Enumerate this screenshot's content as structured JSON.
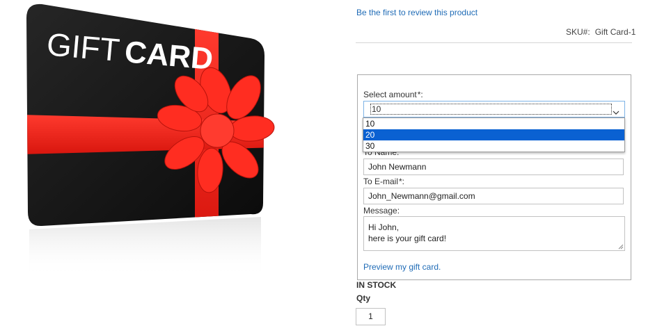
{
  "product_image": {
    "card_text_light": "GIFT",
    "card_text_bold": "CARD",
    "card_color": "#151515",
    "ribbon_color": "#f2231b"
  },
  "review": {
    "link_text": "Be the first to review this product"
  },
  "sku": {
    "label": "SKU#:",
    "value": "Gift Card-1"
  },
  "giftcard_form": {
    "amount": {
      "label": "Select amount",
      "required_mark": "*:",
      "selected_value": "10",
      "options": [
        "10",
        "20",
        "30"
      ],
      "highlighted_option": "20"
    },
    "to_name": {
      "label": "To Name:",
      "value": "John Newmann"
    },
    "to_email": {
      "label": "To E-mail",
      "required_mark": "*:",
      "value": "John_Newmann@gmail.com"
    },
    "message": {
      "label": "Message:",
      "line1": "Hi John,",
      "line2": "here is your gift card!"
    },
    "preview_link": "Preview my gift card."
  },
  "stock_status": "IN STOCK",
  "qty": {
    "label": "Qty",
    "value": "1"
  },
  "colors": {
    "link": "#1f6bb6",
    "option_highlight": "#0a61d2",
    "select_focus_border": "#7db3e6"
  }
}
